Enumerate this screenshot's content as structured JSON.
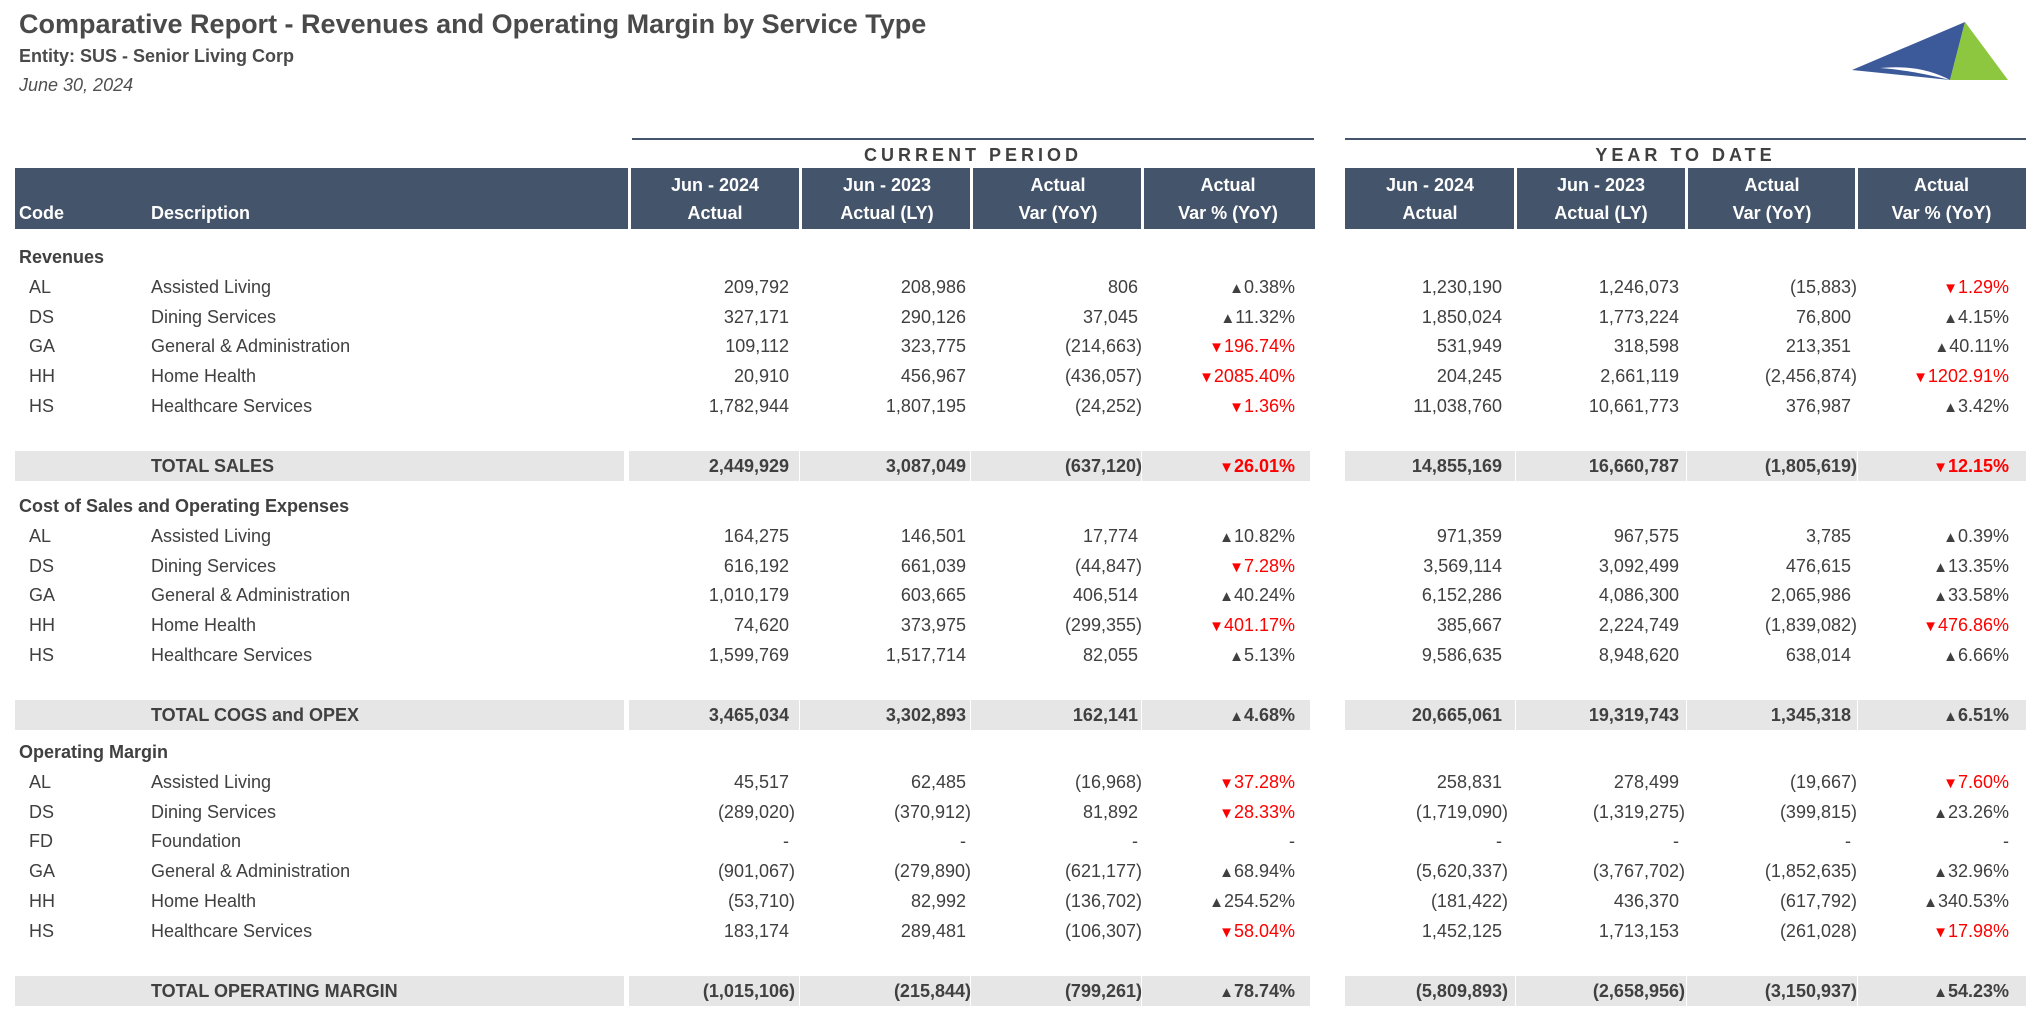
{
  "report": {
    "title": "Comparative Report - Revenues and Operating Margin by Service Type",
    "entity": "Entity: SUS - Senior Living Corp",
    "date": "June 30, 2024"
  },
  "groups": {
    "current": "CURRENT PERIOD",
    "ytd": "YEAR TO DATE"
  },
  "columns": {
    "code": "Code",
    "description": "Description",
    "c1": [
      "Jun - 2024",
      "Actual"
    ],
    "c2": [
      "Jun - 2023",
      "Actual (LY)"
    ],
    "c3": [
      "Actual",
      "Var (YoY)"
    ],
    "c4": [
      "Actual",
      "Var % (YoY)"
    ],
    "y1": [
      "Jun - 2024",
      "Actual"
    ],
    "y2": [
      "Jun - 2023",
      "Actual (LY)"
    ],
    "y3": [
      "Actual",
      "Var (YoY)"
    ],
    "y4": [
      "Actual",
      "Var % (YoY)"
    ]
  },
  "colors": {
    "header_bg": "#44546a",
    "total_bg": "#e6e6e6",
    "negative": "#ff0000",
    "up_arrow": "#404040",
    "logo_blue": "#3c5a9a",
    "logo_green": "#8dc63f"
  },
  "sections": [
    {
      "title": "Revenues",
      "rows": [
        {
          "code": "AL",
          "desc": "Assisted Living",
          "c1": "209,792",
          "c2": "208,986",
          "c3": "806",
          "c4": "0.38%",
          "c4dir": "up",
          "y1": "1,230,190",
          "y2": "1,246,073",
          "y3": "(15,883)",
          "y4": "1.29%",
          "y4dir": "down"
        },
        {
          "code": "DS",
          "desc": "Dining Services",
          "c1": "327,171",
          "c2": "290,126",
          "c3": "37,045",
          "c4": "11.32%",
          "c4dir": "up",
          "y1": "1,850,024",
          "y2": "1,773,224",
          "y3": "76,800",
          "y4": "4.15%",
          "y4dir": "up"
        },
        {
          "code": "GA",
          "desc": "General & Administration",
          "c1": "109,112",
          "c2": "323,775",
          "c3": "(214,663)",
          "c4": "196.74%",
          "c4dir": "down",
          "y1": "531,949",
          "y2": "318,598",
          "y3": "213,351",
          "y4": "40.11%",
          "y4dir": "up"
        },
        {
          "code": "HH",
          "desc": "Home Health",
          "c1": "20,910",
          "c2": "456,967",
          "c3": "(436,057)",
          "c4": "2085.40%",
          "c4dir": "down",
          "y1": "204,245",
          "y2": "2,661,119",
          "y3": "(2,456,874)",
          "y4": "1202.91%",
          "y4dir": "down"
        },
        {
          "code": "HS",
          "desc": "Healthcare Services",
          "c1": "1,782,944",
          "c2": "1,807,195",
          "c3": "(24,252)",
          "c4": "1.36%",
          "c4dir": "down",
          "y1": "11,038,760",
          "y2": "10,661,773",
          "y3": "376,987",
          "y4": "3.42%",
          "y4dir": "up"
        }
      ],
      "total": {
        "label": "TOTAL SALES",
        "c1": "2,449,929",
        "c2": "3,087,049",
        "c3": "(637,120)",
        "c4": "26.01%",
        "c4dir": "down",
        "y1": "14,855,169",
        "y2": "16,660,787",
        "y3": "(1,805,619)",
        "y4": "12.15%",
        "y4dir": "down"
      }
    },
    {
      "title": "Cost of Sales and Operating Expenses",
      "rows": [
        {
          "code": "AL",
          "desc": "Assisted Living",
          "c1": "164,275",
          "c2": "146,501",
          "c3": "17,774",
          "c4": "10.82%",
          "c4dir": "up",
          "y1": "971,359",
          "y2": "967,575",
          "y3": "3,785",
          "y4": "0.39%",
          "y4dir": "up"
        },
        {
          "code": "DS",
          "desc": "Dining Services",
          "c1": "616,192",
          "c2": "661,039",
          "c3": "(44,847)",
          "c4": "7.28%",
          "c4dir": "down",
          "y1": "3,569,114",
          "y2": "3,092,499",
          "y3": "476,615",
          "y4": "13.35%",
          "y4dir": "up"
        },
        {
          "code": "GA",
          "desc": "General & Administration",
          "c1": "1,010,179",
          "c2": "603,665",
          "c3": "406,514",
          "c4": "40.24%",
          "c4dir": "up",
          "y1": "6,152,286",
          "y2": "4,086,300",
          "y3": "2,065,986",
          "y4": "33.58%",
          "y4dir": "up"
        },
        {
          "code": "HH",
          "desc": "Home Health",
          "c1": "74,620",
          "c2": "373,975",
          "c3": "(299,355)",
          "c4": "401.17%",
          "c4dir": "down",
          "y1": "385,667",
          "y2": "2,224,749",
          "y3": "(1,839,082)",
          "y4": "476.86%",
          "y4dir": "down"
        },
        {
          "code": "HS",
          "desc": "Healthcare Services",
          "c1": "1,599,769",
          "c2": "1,517,714",
          "c3": "82,055",
          "c4": "5.13%",
          "c4dir": "up",
          "y1": "9,586,635",
          "y2": "8,948,620",
          "y3": "638,014",
          "y4": "6.66%",
          "y4dir": "up"
        }
      ],
      "total": {
        "label": "TOTAL COGS and OPEX",
        "c1": "3,465,034",
        "c2": "3,302,893",
        "c3": "162,141",
        "c4": "4.68%",
        "c4dir": "up",
        "y1": "20,665,061",
        "y2": "19,319,743",
        "y3": "1,345,318",
        "y4": "6.51%",
        "y4dir": "up"
      }
    },
    {
      "title": "Operating Margin",
      "rows": [
        {
          "code": "AL",
          "desc": "Assisted Living",
          "c1": "45,517",
          "c2": "62,485",
          "c3": "(16,968)",
          "c4": "37.28%",
          "c4dir": "down",
          "y1": "258,831",
          "y2": "278,499",
          "y3": "(19,667)",
          "y4": "7.60%",
          "y4dir": "down"
        },
        {
          "code": "DS",
          "desc": "Dining Services",
          "c1": "(289,020)",
          "c2": "(370,912)",
          "c3": "81,892",
          "c4": "28.33%",
          "c4dir": "down",
          "y1": "(1,719,090)",
          "y2": "(1,319,275)",
          "y3": "(399,815)",
          "y4": "23.26%",
          "y4dir": "up"
        },
        {
          "code": "FD",
          "desc": "Foundation",
          "c1": "-",
          "c2": "-",
          "c3": "-",
          "c4": "-",
          "c4dir": "none",
          "y1": "-",
          "y2": "-",
          "y3": "-",
          "y4": "-",
          "y4dir": "none"
        },
        {
          "code": "GA",
          "desc": "General & Administration",
          "c1": "(901,067)",
          "c2": "(279,890)",
          "c3": "(621,177)",
          "c4": "68.94%",
          "c4dir": "up",
          "y1": "(5,620,337)",
          "y2": "(3,767,702)",
          "y3": "(1,852,635)",
          "y4": "32.96%",
          "y4dir": "up"
        },
        {
          "code": "HH",
          "desc": "Home Health",
          "c1": "(53,710)",
          "c2": "82,992",
          "c3": "(136,702)",
          "c4": "254.52%",
          "c4dir": "up",
          "y1": "(181,422)",
          "y2": "436,370",
          "y3": "(617,792)",
          "y4": "340.53%",
          "y4dir": "up"
        },
        {
          "code": "HS",
          "desc": "Healthcare Services",
          "c1": "183,174",
          "c2": "289,481",
          "c3": "(106,307)",
          "c4": "58.04%",
          "c4dir": "down",
          "y1": "1,452,125",
          "y2": "1,713,153",
          "y3": "(261,028)",
          "y4": "17.98%",
          "y4dir": "down"
        }
      ],
      "total": {
        "label": "TOTAL OPERATING MARGIN",
        "c1": "(1,015,106)",
        "c2": "(215,844)",
        "c3": "(799,261)",
        "c4": "78.74%",
        "c4dir": "up",
        "y1": "(5,809,893)",
        "y2": "(2,658,956)",
        "y3": "(3,150,937)",
        "y4": "54.23%",
        "y4dir": "up"
      }
    }
  ]
}
